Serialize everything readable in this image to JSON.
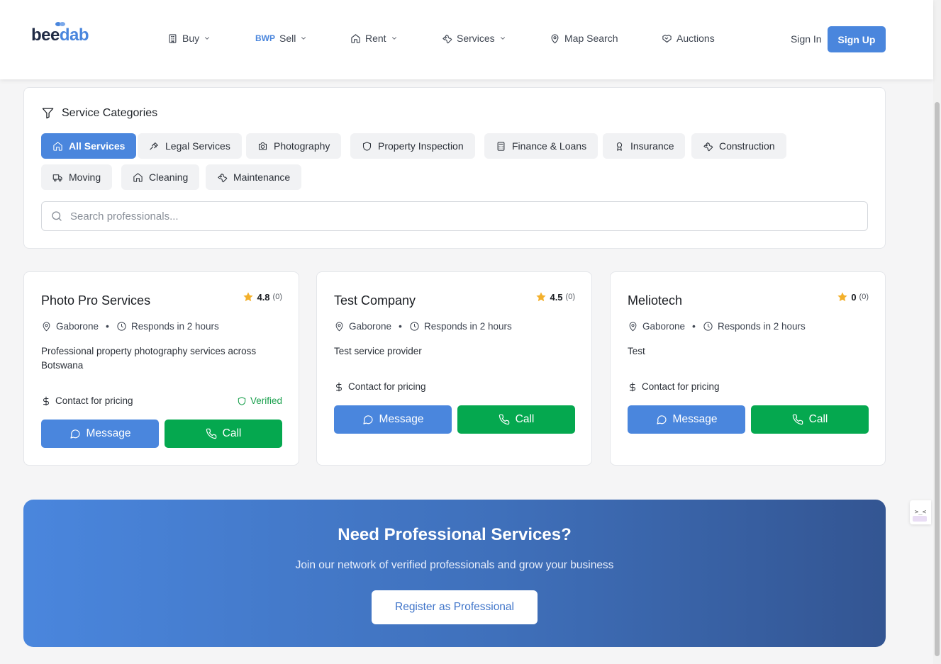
{
  "header": {
    "logo_bee": "bee",
    "logo_dab": "dab",
    "nav": [
      {
        "label": "Buy",
        "icon": "building-icon",
        "dropdown": true
      },
      {
        "label": "Sell",
        "prefix": "BWP",
        "dropdown": true
      },
      {
        "label": "Rent",
        "icon": "home-icon",
        "dropdown": true
      },
      {
        "label": "Services",
        "icon": "wrench-icon",
        "dropdown": true
      },
      {
        "label": "Map Search",
        "icon": "map-pin-icon",
        "dropdown": false
      },
      {
        "label": "Auctions",
        "icon": "handshake-icon",
        "dropdown": false
      }
    ],
    "sign_in": "Sign In",
    "sign_up": "Sign Up"
  },
  "filters": {
    "title": "Service Categories",
    "categories": [
      {
        "label": "All Services",
        "icon": "home-icon",
        "active": true
      },
      {
        "label": "Legal Services",
        "icon": "gavel-icon",
        "active": false
      },
      {
        "label": "Photography",
        "icon": "camera-icon",
        "active": false
      },
      {
        "label": "Property Inspection",
        "icon": "shield-icon",
        "active": false
      },
      {
        "label": "Finance & Loans",
        "icon": "calculator-icon",
        "active": false
      },
      {
        "label": "Insurance",
        "icon": "award-icon",
        "active": false
      },
      {
        "label": "Construction",
        "icon": "wrench-icon",
        "active": false
      },
      {
        "label": "Moving",
        "icon": "truck-icon",
        "active": false
      },
      {
        "label": "Cleaning",
        "icon": "home-icon",
        "active": false
      },
      {
        "label": "Maintenance",
        "icon": "wrench-icon",
        "active": false
      }
    ],
    "search_placeholder": "Search professionals..."
  },
  "providers": [
    {
      "name": "Photo Pro Services",
      "rating": "4.8",
      "reviews": "(0)",
      "location": "Gaborone",
      "response": "Responds in 2 hours",
      "description": "Professional property photography services across Botswana",
      "pricing": "Contact for pricing",
      "verified": "Verified",
      "message": "Message",
      "call": "Call"
    },
    {
      "name": "Test Company",
      "rating": "4.5",
      "reviews": "(0)",
      "location": "Gaborone",
      "response": "Responds in 2 hours",
      "description": "Test service provider",
      "pricing": "Contact for pricing",
      "message": "Message",
      "call": "Call"
    },
    {
      "name": "Meliotech",
      "rating": "0",
      "reviews": "(0)",
      "location": "Gaborone",
      "response": "Responds in 2 hours",
      "description": "Test",
      "pricing": "Contact for pricing",
      "message": "Message",
      "call": "Call"
    }
  ],
  "cta": {
    "title": "Need Professional Services?",
    "subtitle": "Join our network of verified professionals and grow your business",
    "button": "Register as Professional"
  },
  "widget": {
    "glyph": ">_<"
  },
  "colors": {
    "primary": "#4a86dd",
    "call_green": "#05a84f",
    "star": "#f3b02b",
    "verified": "#1aa04d"
  }
}
